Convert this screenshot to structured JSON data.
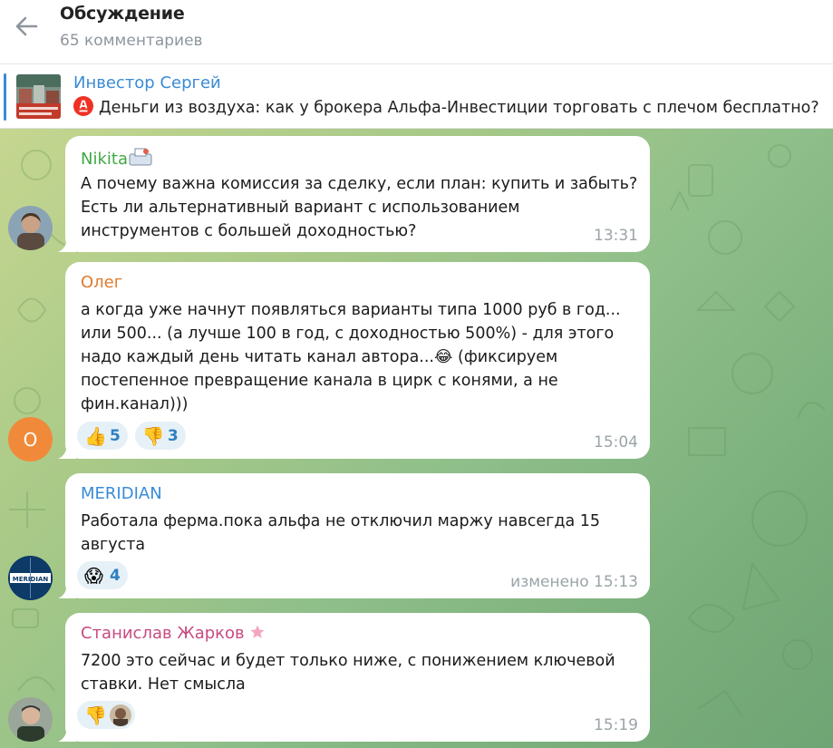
{
  "header": {
    "title": "Обсуждение",
    "subtitle": "65 комментариев"
  },
  "pinned": {
    "author": "Инвестор Сергей",
    "text": "Деньги из воздуха: как у брокера Альфа-Инвестиции торговать с плечом бесплатно?"
  },
  "colors": {
    "accent": "#3a8bd6",
    "alfa_red": "#ef3124",
    "author_nikita": "#3fa843",
    "author_oleg": "#e07b2c",
    "author_meridian": "#3a8bd6",
    "author_stanislav": "#c74a80"
  },
  "comments": [
    {
      "author": "Nikita",
      "author_emoji": "📨",
      "text": "А почему важна комиссия за сделку, если план: купить и забыть? Есть ли альтернативный вариант с использованием инструментов с большей доходностью?",
      "time": "13:31"
    },
    {
      "author": "Олег",
      "avatar_letter": "О",
      "text": "а когда уже начнут появляться варианты типа 1000 руб в год... или 500... (а лучше 100 в год, с доходностью 500%) - для этого надо каждый день читать канал автора...😂 (фиксируем постепенное превращение канала в цирк с конями, а не фин.канал)))",
      "reactions": [
        {
          "emoji": "👍",
          "count": "5"
        },
        {
          "emoji": "👎",
          "count": "3"
        }
      ],
      "time": "15:04"
    },
    {
      "author": "MERIDIAN",
      "text": "Работала ферма.пока альфа не отключил маржу навсегда 15 августа",
      "reactions": [
        {
          "emoji": "😱",
          "count": "4"
        }
      ],
      "time": "изменено 15:13",
      "avatar_label": "MERIDIAN"
    },
    {
      "author": "Станислав Жарков",
      "author_emoji": "⭐",
      "text": "7200 это сейчас и будет только ниже, с понижением ключевой ставки. Нет смысла",
      "reactions": [
        {
          "emoji": "👎",
          "count": ""
        }
      ],
      "time": "15:19"
    }
  ]
}
